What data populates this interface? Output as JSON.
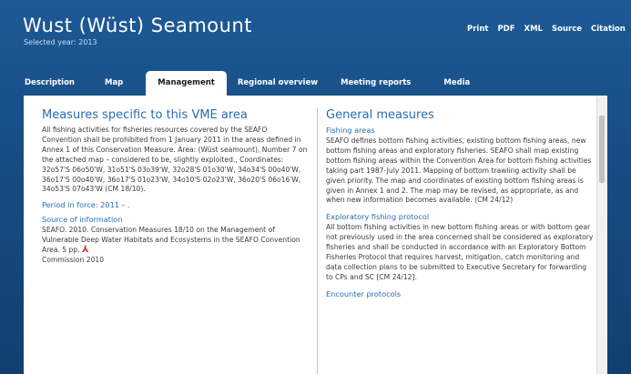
{
  "header": {
    "title": "Wust (Wüst) Seamount",
    "subtitle": "Selected year: 2013",
    "links": [
      "Print",
      "PDF",
      "XML",
      "Source",
      "Citation"
    ]
  },
  "tabs": [
    {
      "label": "Description"
    },
    {
      "label": "Map"
    },
    {
      "label": "Management",
      "active": true
    },
    {
      "label": "Regional overview"
    },
    {
      "label": "Meeting reports"
    },
    {
      "label": "Media"
    }
  ],
  "left": {
    "heading": "Measures specific to this VME area",
    "text": "All fishing activities for fisheries resources covered by the SEAFO Convention shall be prohibited from 1 January 2011 in the areas defined in Annex 1 of this Conservation Measure. Area: (Wüst seamount), Number 7 on the attached map – considered to be, slightly exploited., Coordinates: 32o57'S 06o50'W, 31o51'S 03o39'W, 32o28'S 01o30'W, 34o34'S 00o40'W, 36o17'S 00o40'W, 36o17'S 01o23'W, 34o10'S 02o23'W, 36o20'S 06o16'W, 34o53'S 07o43'W (CM 18/10).",
    "period": "Period in force: 2011 – .",
    "source_label": "Source of information",
    "source_text": "SEAFO. 2010. Conservation Measures 18/10 on the Management of Vulnerable Deep Water Habitats and Ecosystems in the SEAFO Convention Area. 5 pp.",
    "source_text2": "Commission 2010"
  },
  "right": {
    "heading": "General measures",
    "s1_label": "Fishing areas",
    "s1_text": "SEAFO defines bottom fishing activities, existing bottom fishing areas, new bottom fishing areas and exploratory fisheries. SEAFO shall map existing bottom fishing areas within the Convention Area for bottom fishing activities taking part 1987-July 2011. Mapping of bottom trawling activity shall be given priority. The map and coordinates of existing bottom fishing areas is given in Annex 1 and 2. The map may be revised, as appropriate, as and when new information becomes available. (CM 24/12)",
    "s2_label": "Exploratory fishing protocol",
    "s2_text": "All bottom fishing activities in new bottom fishing areas or with bottom gear not previously used in the area concerned shall be considered as exploratory fisheries and shall be conducted in accordance with an Exploratory Bottom Fisheries Protocol that requires harvest, mitigation, catch monitoring and data collection plans to be submitted to Executive Secretary for forwarding to CPs and SC [CM 24/12].",
    "s3_label": "Encounter protocols"
  },
  "icons": {
    "pdf": "pdf-icon"
  }
}
